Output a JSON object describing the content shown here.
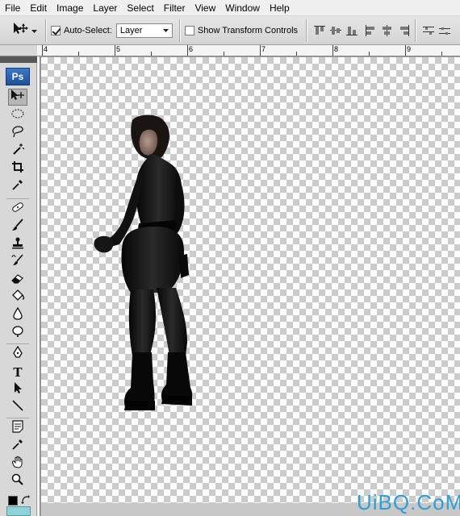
{
  "menubar": {
    "items": [
      "File",
      "Edit",
      "Image",
      "Layer",
      "Select",
      "Filter",
      "View",
      "Window",
      "Help"
    ]
  },
  "options": {
    "auto_select_label": "Auto-Select:",
    "auto_select_checked": true,
    "layer_select_value": "Layer",
    "show_transform_label": "Show Transform Controls",
    "show_transform_checked": false
  },
  "ruler": {
    "marks": [
      "4",
      "5",
      "6",
      "7",
      "8",
      "9"
    ]
  },
  "toolpanel": {
    "logo": "Ps"
  },
  "watermark": "UiBQ.CoM"
}
